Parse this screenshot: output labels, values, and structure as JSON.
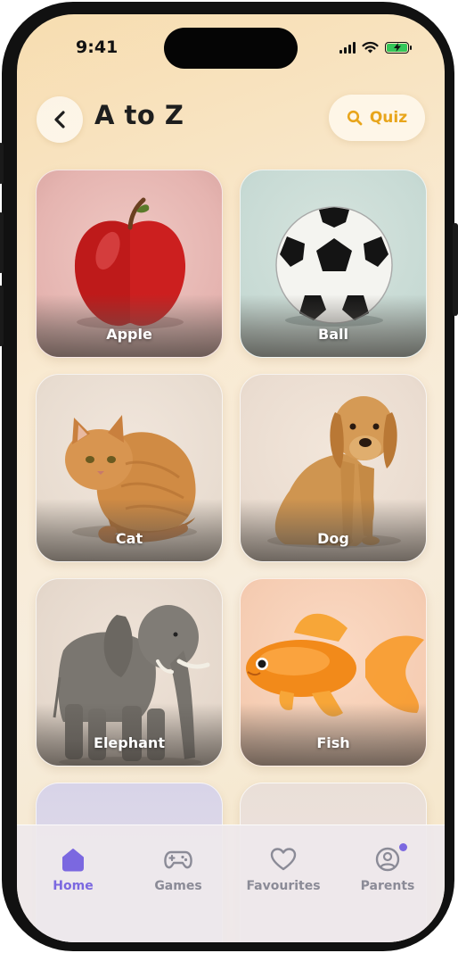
{
  "status_bar": {
    "time": "9:41"
  },
  "header": {
    "title": "A to Z",
    "quiz_label": "Quiz"
  },
  "cards": [
    {
      "label": "Apple"
    },
    {
      "label": "Ball"
    },
    {
      "label": "Cat"
    },
    {
      "label": "Dog"
    },
    {
      "label": "Elephant"
    },
    {
      "label": "Fish"
    }
  ],
  "tabbar": {
    "items": [
      {
        "label": "Home",
        "icon": "home-icon",
        "active": true
      },
      {
        "label": "Games",
        "icon": "gamepad-icon",
        "active": false
      },
      {
        "label": "Favourites",
        "icon": "heart-icon",
        "active": false
      },
      {
        "label": "Parents",
        "icon": "user-circle-icon",
        "active": false,
        "badge": true
      }
    ]
  },
  "colors": {
    "accent": "#7b68e0",
    "quiz": "#e8a51b",
    "battery": "#34c759"
  }
}
